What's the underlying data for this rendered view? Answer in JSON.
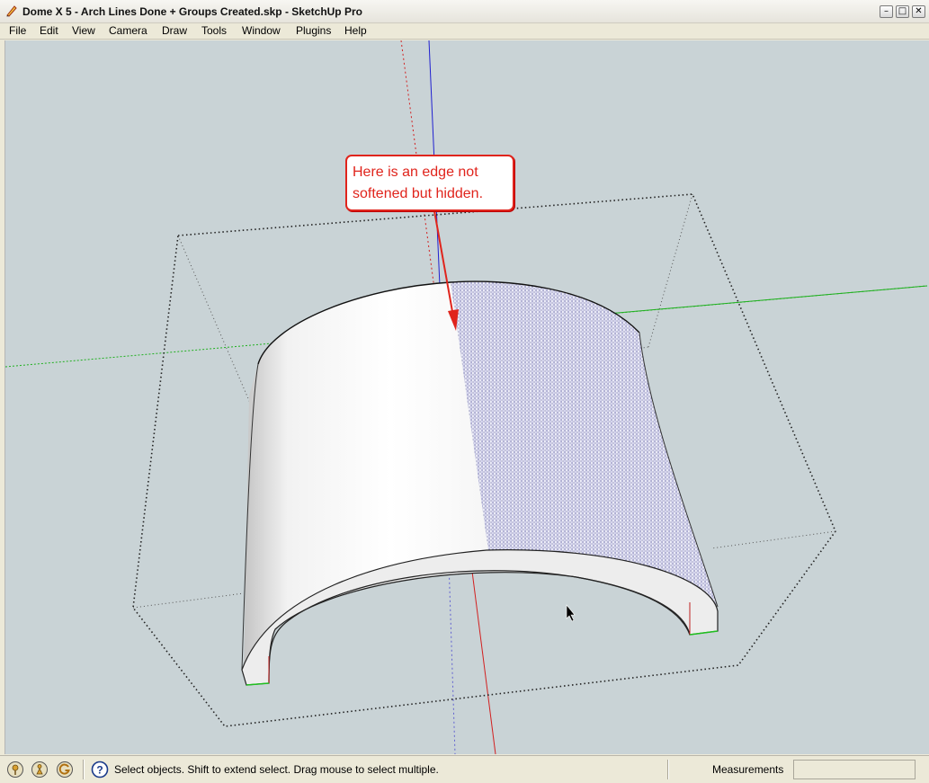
{
  "window": {
    "title": "Dome X 5 - Arch Lines Done + Groups Created.skp - SketchUp Pro",
    "buttons": {
      "minimize": "–",
      "maximize": "□",
      "close": "✕"
    }
  },
  "menu": [
    "File",
    "Edit",
    "View",
    "Camera",
    "Draw",
    "Tools",
    "Window",
    "Plugins",
    "Help"
  ],
  "callout": {
    "line1": "Here is an edge not",
    "line2": "softened but hidden.",
    "color": "#e0241c"
  },
  "statusbar": {
    "icons": [
      "geo-location-icon",
      "credits-icon",
      "google-sign-in-icon"
    ],
    "help_icon": "question-mark-icon",
    "message": "Select objects. Shift to extend select. Drag mouse to select multiple.",
    "measurements_label": "Measurements",
    "measurements_value": ""
  },
  "colors": {
    "viewport_bg": "#c9d3d6",
    "axis_red": "#d22020",
    "axis_green": "#20b020",
    "axis_blue": "#2020d0"
  }
}
